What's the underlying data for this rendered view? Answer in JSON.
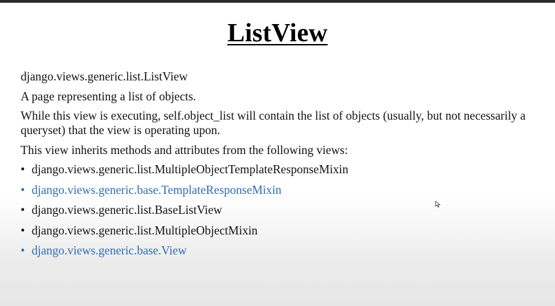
{
  "title": "ListView",
  "class_path": "django.views.generic.list.ListView",
  "description": "A page representing a list of objects.",
  "execution_note": "While this view is executing, self.object_list will contain the list of objects (usually, but not necessarily a queryset) that the view is operating upon.",
  "inherits_intro": "This view inherits methods and attributes from the following views:",
  "bullet_symbol": "•",
  "inherits": [
    {
      "label": "django.views.generic.list.MultipleObjectTemplateResponseMixin",
      "is_link": false
    },
    {
      "label": "django.views.generic.base.TemplateResponseMixin",
      "is_link": true
    },
    {
      "label": "django.views.generic.list.BaseListView",
      "is_link": false
    },
    {
      "label": "django.views.generic.list.MultipleObjectMixin",
      "is_link": false
    },
    {
      "label": "django.views.generic.base.View",
      "is_link": true
    }
  ],
  "colors": {
    "text": "#111111",
    "link": "#2e6bb4",
    "background": "#ffffff"
  }
}
